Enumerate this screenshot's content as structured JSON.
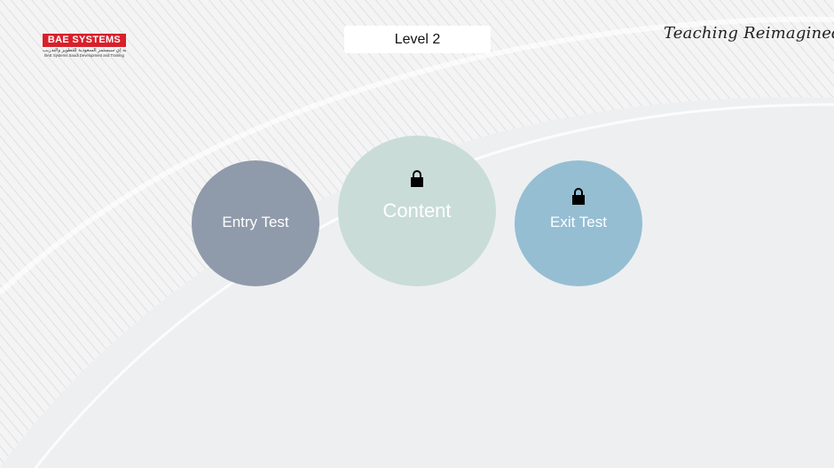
{
  "header": {
    "logo_text": "BAE SYSTEMS",
    "logo_arabic": "بي إيه إي سيستمز السعودية للتطوير والتدريب",
    "logo_subtitle": "BAE Systems Saudi Development and Training",
    "level_title": "Level 2",
    "tagline": "Teaching Reimagined"
  },
  "modules": [
    {
      "label": "Entry Test",
      "locked": false,
      "color": "#8f9aaa"
    },
    {
      "label": "Content",
      "locked": true,
      "color": "#c9dcd8",
      "icon": "lock-icon"
    },
    {
      "label": "Exit Test",
      "locked": true,
      "color": "#95bed3",
      "icon": "lock-icon"
    }
  ],
  "colors": {
    "background": "#eeeff1",
    "brand_red": "#d8202b"
  }
}
